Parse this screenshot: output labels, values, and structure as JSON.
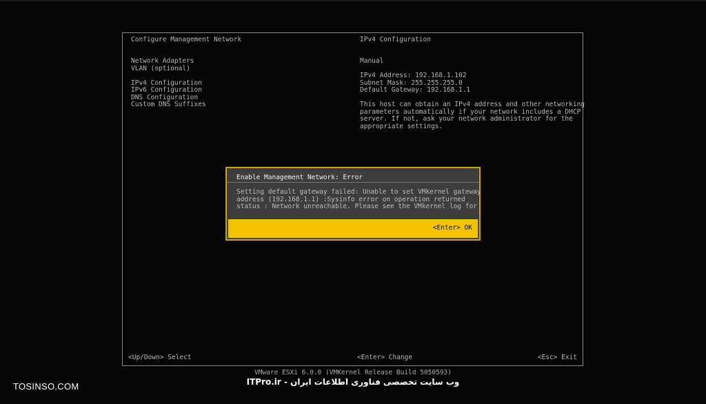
{
  "left_panel": {
    "title": "Configure Management Network",
    "menu": [
      "Network Adapters",
      "VLAN (optional)",
      "IPv4 Configuration",
      "IPv6 Configuration",
      "DNS Configuration",
      "Custom DNS Suffixes"
    ]
  },
  "right_panel": {
    "title": "IPv4 Configuration",
    "mode": "Manual",
    "ipv4_address": "IPv4 Address: 192.168.1.102",
    "subnet_mask": "Subnet Mask: 255.255.255.0",
    "default_gateway": "Default Gateway: 192.168.1.1",
    "description_lines": [
      "This host can obtain an IPv4 address and other networking",
      "parameters automatically if your network includes a DHCP",
      "server. If not, ask your network administrator for the",
      "appropriate settings."
    ]
  },
  "dialog": {
    "title": "Enable Management Network: Error",
    "message_lines": [
      "Setting default gateway failed: Unable to set VMkernel gateway",
      "address (192.168.1.1) :Sysinfo error on operation returned",
      "status : Network unreachable. Please see the VMkernel log for"
    ],
    "ok_label": "<Enter> OK",
    "accent_color": "#f5c400"
  },
  "bottom_bar": {
    "left": "<Up/Down> Select",
    "center": "<Enter> Change",
    "right": "<Esc> Exit"
  },
  "footer": {
    "version": "VMware ESXi 6.0.0 (VMKernel Release Build 5050593)"
  },
  "watermark": {
    "left": "TOSINSO.COM",
    "center": "ITPro.ir - وب سایت تخصصی فناوری اطلاعات ایران"
  }
}
